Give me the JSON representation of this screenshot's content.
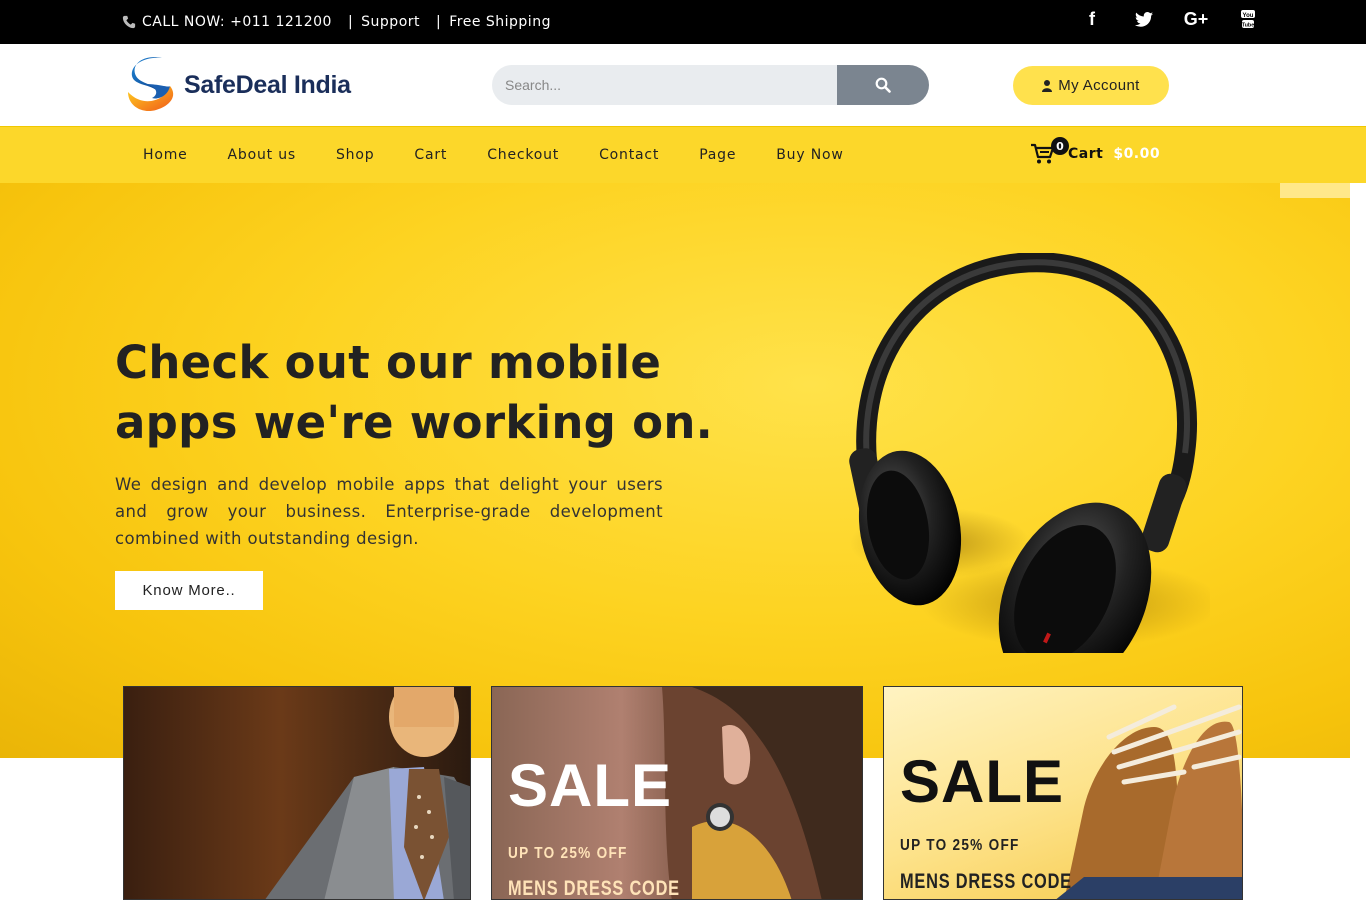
{
  "topbar": {
    "phone_icon": "phone-icon",
    "call": "CALL NOW: +011 121200",
    "support": "Support",
    "shipping": "Free Shipping",
    "social": [
      "facebook-icon",
      "twitter-icon",
      "google-plus-icon",
      "youtube-icon"
    ]
  },
  "header": {
    "logo_text": "SafeDeal India",
    "search_placeholder": "Search...",
    "account_label": "My Account"
  },
  "nav": {
    "items": [
      "Home",
      "About us",
      "Shop",
      "Cart",
      "Checkout",
      "Contact",
      "Page",
      "Buy Now"
    ],
    "cart_count": "0",
    "cart_label": "Cart",
    "cart_total": "$0.00"
  },
  "hero": {
    "title": "Check out our mobile apps we're working on.",
    "text": "We design and develop mobile apps that delight your users and grow your business. Enterprise-grade development combined with outstanding design.",
    "button": "Know More.."
  },
  "promos": [
    {},
    {
      "sale": "SALE",
      "offer": "UP TO 25% OFF",
      "code": "MENS DRESS CODE"
    },
    {
      "sale": "SALE",
      "offer": "UP TO 25% OFF",
      "code": "MENS DRESS CODE"
    }
  ],
  "colors": {
    "accent": "#fcd72a",
    "account_bg": "#ffe14d",
    "topbar": "#000000"
  }
}
